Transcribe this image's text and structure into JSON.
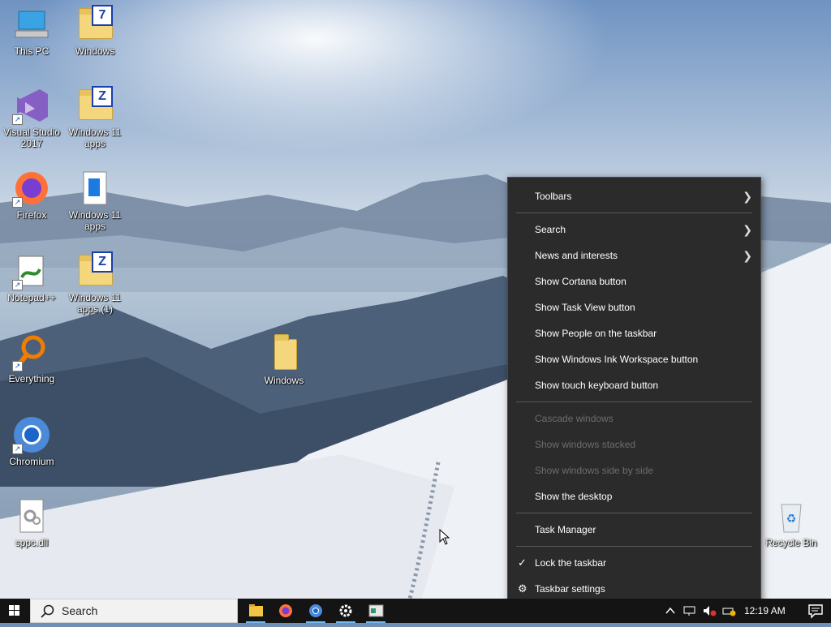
{
  "desktop": {
    "icons": [
      {
        "label": "This PC",
        "icon": "computer-icon"
      },
      {
        "label": "Windows",
        "icon": "folder-icon"
      },
      {
        "label": "Visual Studio 2017",
        "icon": "visual-studio-icon"
      },
      {
        "label": "Windows 11 apps",
        "icon": "folder-icon"
      },
      {
        "label": "Firefox",
        "icon": "firefox-icon"
      },
      {
        "label": "Windows 11 apps",
        "icon": "file-icon"
      },
      {
        "label": "Notepad++",
        "icon": "notepad-plus-plus-icon"
      },
      {
        "label": "Windows 11 apps (1)",
        "icon": "folder-icon"
      },
      {
        "label": "Everything",
        "icon": "everything-search-icon"
      },
      {
        "label": "Chromium",
        "icon": "chromium-icon"
      },
      {
        "label": "sppc.dll",
        "icon": "dll-file-icon"
      },
      {
        "label": "Windows",
        "icon": "folder-icon"
      },
      {
        "label": "Recycle Bin",
        "icon": "recycle-bin-icon"
      }
    ]
  },
  "context_menu": {
    "items": [
      {
        "label": "Toolbars",
        "submenu": true
      },
      {
        "label": "Search",
        "submenu": true
      },
      {
        "label": "News and interests",
        "submenu": true
      },
      {
        "label": "Show Cortana button"
      },
      {
        "label": "Show Task View button"
      },
      {
        "label": "Show People on the taskbar"
      },
      {
        "label": "Show Windows Ink Workspace button"
      },
      {
        "label": "Show touch keyboard button"
      },
      {
        "label": "Cascade windows",
        "disabled": true
      },
      {
        "label": "Show windows stacked",
        "disabled": true
      },
      {
        "label": "Show windows side by side",
        "disabled": true
      },
      {
        "label": "Show the desktop"
      },
      {
        "label": "Task Manager"
      },
      {
        "label": "Lock the taskbar",
        "checked": true
      },
      {
        "label": "Taskbar settings",
        "icon": "gear-icon"
      }
    ]
  },
  "taskbar": {
    "search_label": "Search",
    "apps": [
      "file-explorer-icon",
      "firefox-icon",
      "chromium-icon",
      "settings-icon",
      "app-window-icon"
    ],
    "clock": "12:19 AM"
  },
  "colors": {
    "menu_bg": "#2b2b2b",
    "taskbar_bg": "#141414",
    "accent": "#76b9ed"
  }
}
